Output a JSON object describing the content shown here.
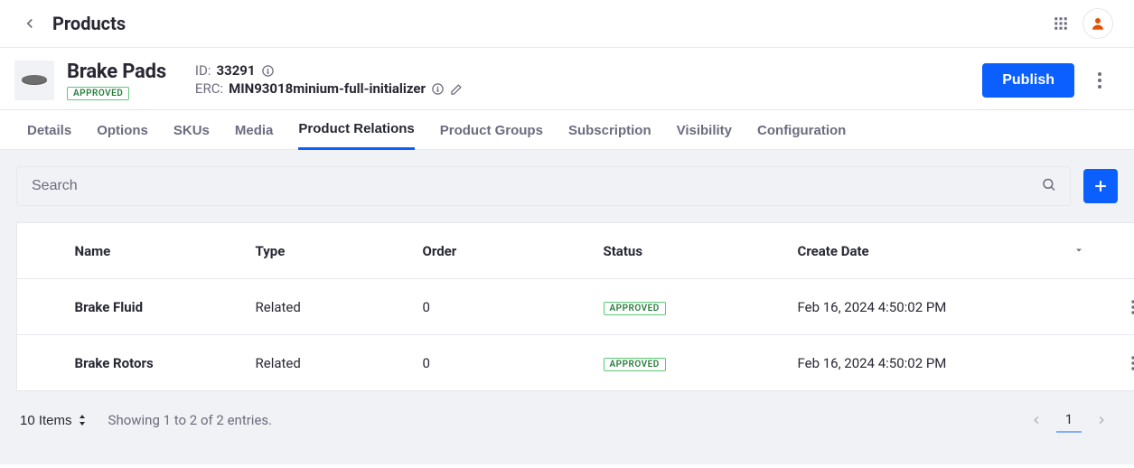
{
  "header": {
    "page_title": "Products"
  },
  "product": {
    "name": "Brake Pads",
    "status_badge": "APPROVED",
    "id_label": "ID:",
    "id_value": "33291",
    "erc_label": "ERC:",
    "erc_value": "MIN93018minium-full-initializer",
    "publish_button": "Publish"
  },
  "tabs": {
    "items": [
      {
        "label": "Details",
        "active": false
      },
      {
        "label": "Options",
        "active": false
      },
      {
        "label": "SKUs",
        "active": false
      },
      {
        "label": "Media",
        "active": false
      },
      {
        "label": "Product Relations",
        "active": true
      },
      {
        "label": "Product Groups",
        "active": false
      },
      {
        "label": "Subscription",
        "active": false
      },
      {
        "label": "Visibility",
        "active": false
      },
      {
        "label": "Configuration",
        "active": false
      }
    ]
  },
  "search": {
    "placeholder": "Search"
  },
  "table": {
    "columns": {
      "name": "Name",
      "type": "Type",
      "order": "Order",
      "status": "Status",
      "create_date": "Create Date"
    },
    "rows": [
      {
        "name": "Brake Fluid",
        "type": "Related",
        "order": "0",
        "status": "APPROVED",
        "create_date": "Feb 16, 2024 4:50:02 PM"
      },
      {
        "name": "Brake Rotors",
        "type": "Related",
        "order": "0",
        "status": "APPROVED",
        "create_date": "Feb 16, 2024 4:50:02 PM"
      }
    ]
  },
  "pagination": {
    "page_size_label": "10 Items",
    "summary": "Showing 1 to 2 of 2 entries.",
    "current_page": "1"
  },
  "colors": {
    "primary": "#0b5fff",
    "success": "#287d3c",
    "avatar": "#e55100"
  }
}
